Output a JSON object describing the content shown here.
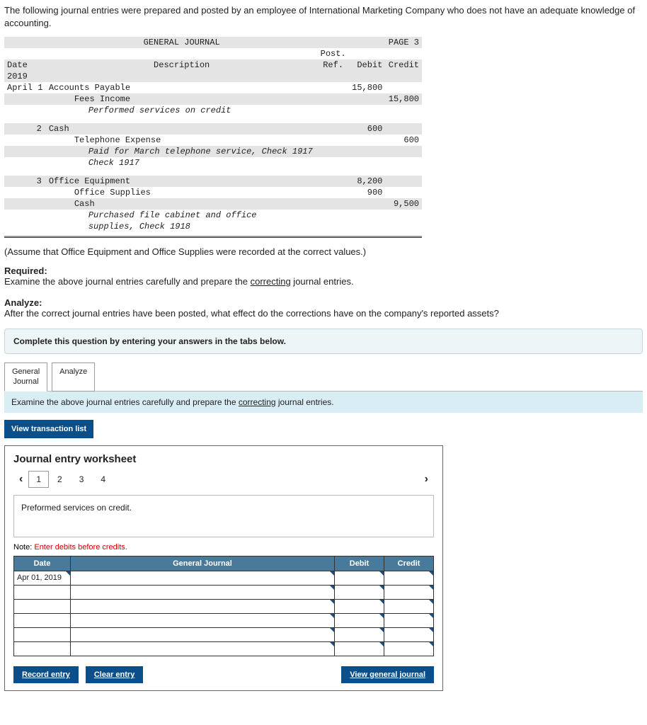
{
  "intro": "The following journal entries were prepared and posted by an employee of International Marketing Company who does not have an adequate knowledge of accounting.",
  "journal": {
    "title": "GENERAL JOURNAL",
    "page": "PAGE 3",
    "cols": {
      "date": "Date",
      "desc": "Description",
      "post": "Post.",
      "ref": "Ref.",
      "debit": "Debit",
      "credit": "Credit"
    },
    "year": "2019",
    "entries": [
      {
        "date": "April 1",
        "lines": [
          {
            "acct": "Accounts Payable",
            "debit": "15,800",
            "credit": ""
          },
          {
            "acct": "Fees Income",
            "debit": "",
            "credit": "15,800",
            "indent": 1
          }
        ],
        "memo": "Performed services on credit"
      },
      {
        "date": "2",
        "lines": [
          {
            "acct": "Cash",
            "debit": "600",
            "credit": ""
          },
          {
            "acct": "Telephone Expense",
            "debit": "",
            "credit": "600",
            "indent": 1
          }
        ],
        "memo": "Paid for March telephone service, Check 1917"
      },
      {
        "date": "3",
        "lines": [
          {
            "acct": "Office Equipment",
            "debit": "8,200",
            "credit": ""
          },
          {
            "acct": "Office Supplies",
            "debit": "900",
            "credit": "",
            "indent": 1
          },
          {
            "acct": "Cash",
            "debit": "",
            "credit": "9,500",
            "indent": 1
          }
        ],
        "memo": "Purchased file cabinet and office supplies, Check 1918"
      }
    ]
  },
  "assume": "(Assume that Office Equipment and Office Supplies were recorded at the correct values.)",
  "required": {
    "label": "Required:",
    "text_a": "Examine the above journal entries carefully and prepare the ",
    "text_u": "correcting",
    "text_b": " journal entries."
  },
  "analyze": {
    "label": "Analyze:",
    "text": "After the correct journal entries have been posted, what effect do the corrections have on the company's reported assets?"
  },
  "tabs_instruction": "Complete this question by entering your answers in the tabs below.",
  "tabs": {
    "t1": "General\nJournal",
    "t2": "Analyze"
  },
  "tab_band": {
    "a": "Examine the above journal entries carefully and prepare the ",
    "u": "correcting",
    "b": " journal entries."
  },
  "view_tx_btn": "View transaction list",
  "worksheet": {
    "title": "Journal entry worksheet",
    "pager": [
      "1",
      "2",
      "3",
      "4"
    ],
    "tx_desc": "Preformed services on credit.",
    "note_a": "Note: ",
    "note_b": "Enter debits before credits.",
    "headers": {
      "date": "Date",
      "gj": "General Journal",
      "debit": "Debit",
      "credit": "Credit"
    },
    "first_date": "Apr 01, 2019",
    "buttons": {
      "record": "Record entry",
      "clear": "Clear entry",
      "view": "View general journal"
    }
  }
}
